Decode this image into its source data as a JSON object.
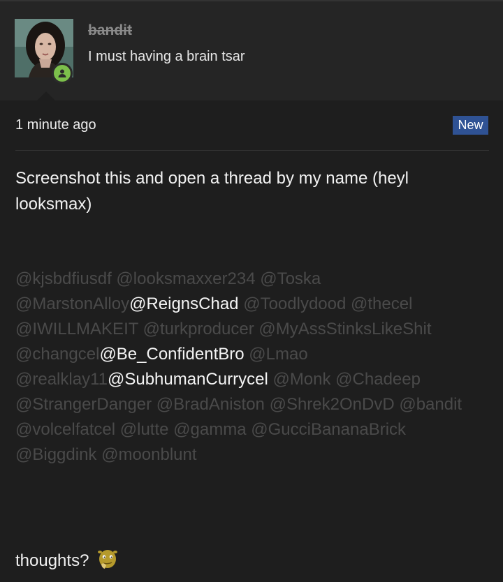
{
  "post": {
    "username": "bandit",
    "user_title": "I must having a brain tsar",
    "timestamp": "1 minute ago",
    "badge": "New",
    "body": "Screenshot this and open a thread by my name (heyl looksmax)",
    "closing": "thoughts?",
    "closing_emoji": "shrek-thinking-icon"
  },
  "mentions": [
    {
      "text": "@kjsbdfiusdf ",
      "highlighted": false
    },
    {
      "text": "@looksmaxxer234 ",
      "highlighted": false
    },
    {
      "text": "@Toska ",
      "highlighted": false
    },
    {
      "text": "@MarstonAlloy",
      "highlighted": false
    },
    {
      "text": "@ReignsChad ",
      "highlighted": true
    },
    {
      "text": "@Toodlydood ",
      "highlighted": false
    },
    {
      "text": "@thecel ",
      "highlighted": false
    },
    {
      "text": "@IWILLMAKEIT ",
      "highlighted": false
    },
    {
      "text": "@turkproducer ",
      "highlighted": false
    },
    {
      "text": "@MyAssStinksLikeShit ",
      "highlighted": false
    },
    {
      "text": "@changcel",
      "highlighted": false
    },
    {
      "text": "@Be_ConfidentBro ",
      "highlighted": true
    },
    {
      "text": "@Lmao ",
      "highlighted": false
    },
    {
      "text": "@realklay11",
      "highlighted": false
    },
    {
      "text": "@SubhumanCurrycel ",
      "highlighted": true
    },
    {
      "text": "@Monk ",
      "highlighted": false
    },
    {
      "text": "@Chadeep ",
      "highlighted": false
    },
    {
      "text": "@StrangerDanger ",
      "highlighted": false
    },
    {
      "text": "@BradAniston ",
      "highlighted": false
    },
    {
      "text": "@Shrek2OnDvD ",
      "highlighted": false
    },
    {
      "text": "@bandit ",
      "highlighted": false
    },
    {
      "text": "@volcelfatcel ",
      "highlighted": false
    },
    {
      "text": "@lutte ",
      "highlighted": false
    },
    {
      "text": "@gamma ",
      "highlighted": false
    },
    {
      "text": "@GucciBananaBrick ",
      "highlighted": false
    },
    {
      "text": "@Biggdink ",
      "highlighted": false
    },
    {
      "text": "@moonblunt",
      "highlighted": false
    }
  ],
  "colors": {
    "background": "#1e1e1e",
    "header_background": "#252525",
    "online_status": "#7cc04b",
    "badge": "#2f5294",
    "mention_dim": "#4a4a4a",
    "mention_highlight": "#f4f4f4"
  }
}
